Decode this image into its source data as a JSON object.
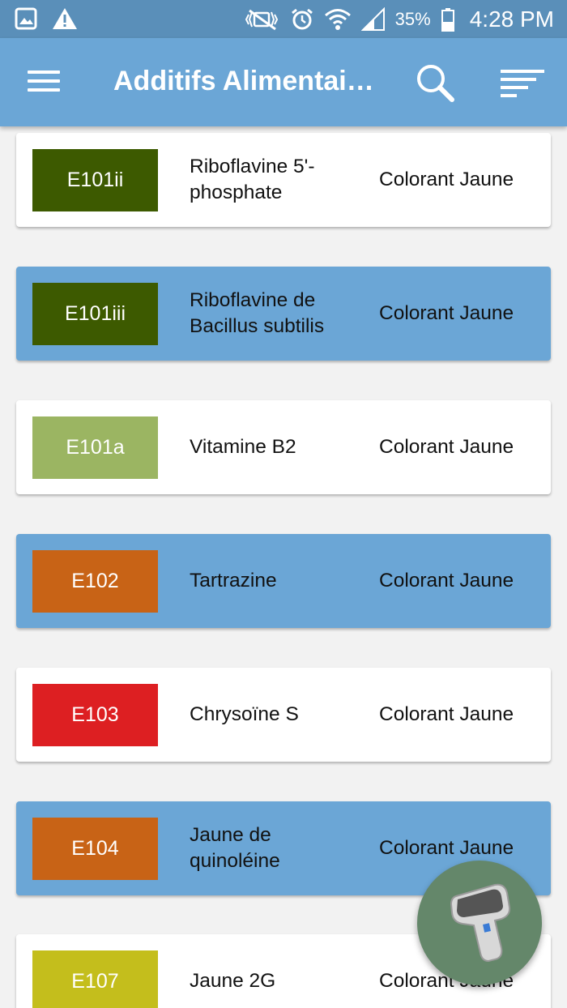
{
  "status_bar": {
    "battery_percent": "35%",
    "time": "4:28 PM",
    "left_icons": [
      "image-icon",
      "warning-icon"
    ],
    "right_icons": [
      "mute-icon",
      "alarm-icon",
      "wifi-icon",
      "signal-icon",
      "battery-icon"
    ]
  },
  "app_bar": {
    "title": "Additifs Alimentai…",
    "background": "#6ba6d6",
    "icons": [
      "menu-icon",
      "search-icon",
      "sort-icon"
    ]
  },
  "additives": [
    {
      "code": "E101ii",
      "name": "Riboflavine 5'-phosphate",
      "category": "Colorant Jaune",
      "color": "#3d5a00",
      "highlighted": false
    },
    {
      "code": "E101iii",
      "name": "Riboflavine de Bacillus subtilis",
      "category": "Colorant Jaune",
      "color": "#3d5a00",
      "highlighted": true
    },
    {
      "code": "E101a",
      "name": "Vitamine B2",
      "category": "Colorant Jaune",
      "color": "#9bb562",
      "highlighted": false
    },
    {
      "code": "E102",
      "name": "Tartrazine",
      "category": "Colorant Jaune",
      "color": "#c86316",
      "highlighted": true
    },
    {
      "code": "E103",
      "name": "Chrysoïne S",
      "category": "Colorant Jaune",
      "color": "#dd1f22",
      "highlighted": false
    },
    {
      "code": "E104",
      "name": "Jaune de quinoléine",
      "category": "Colorant Jaune",
      "color": "#c86316",
      "highlighted": true
    },
    {
      "code": "E107",
      "name": "Jaune 2G",
      "category": "Colorant Jaune",
      "color": "#c4be1c",
      "highlighted": false
    }
  ],
  "fab": {
    "icon": "barcode-scanner-icon",
    "color": "#64876a"
  }
}
